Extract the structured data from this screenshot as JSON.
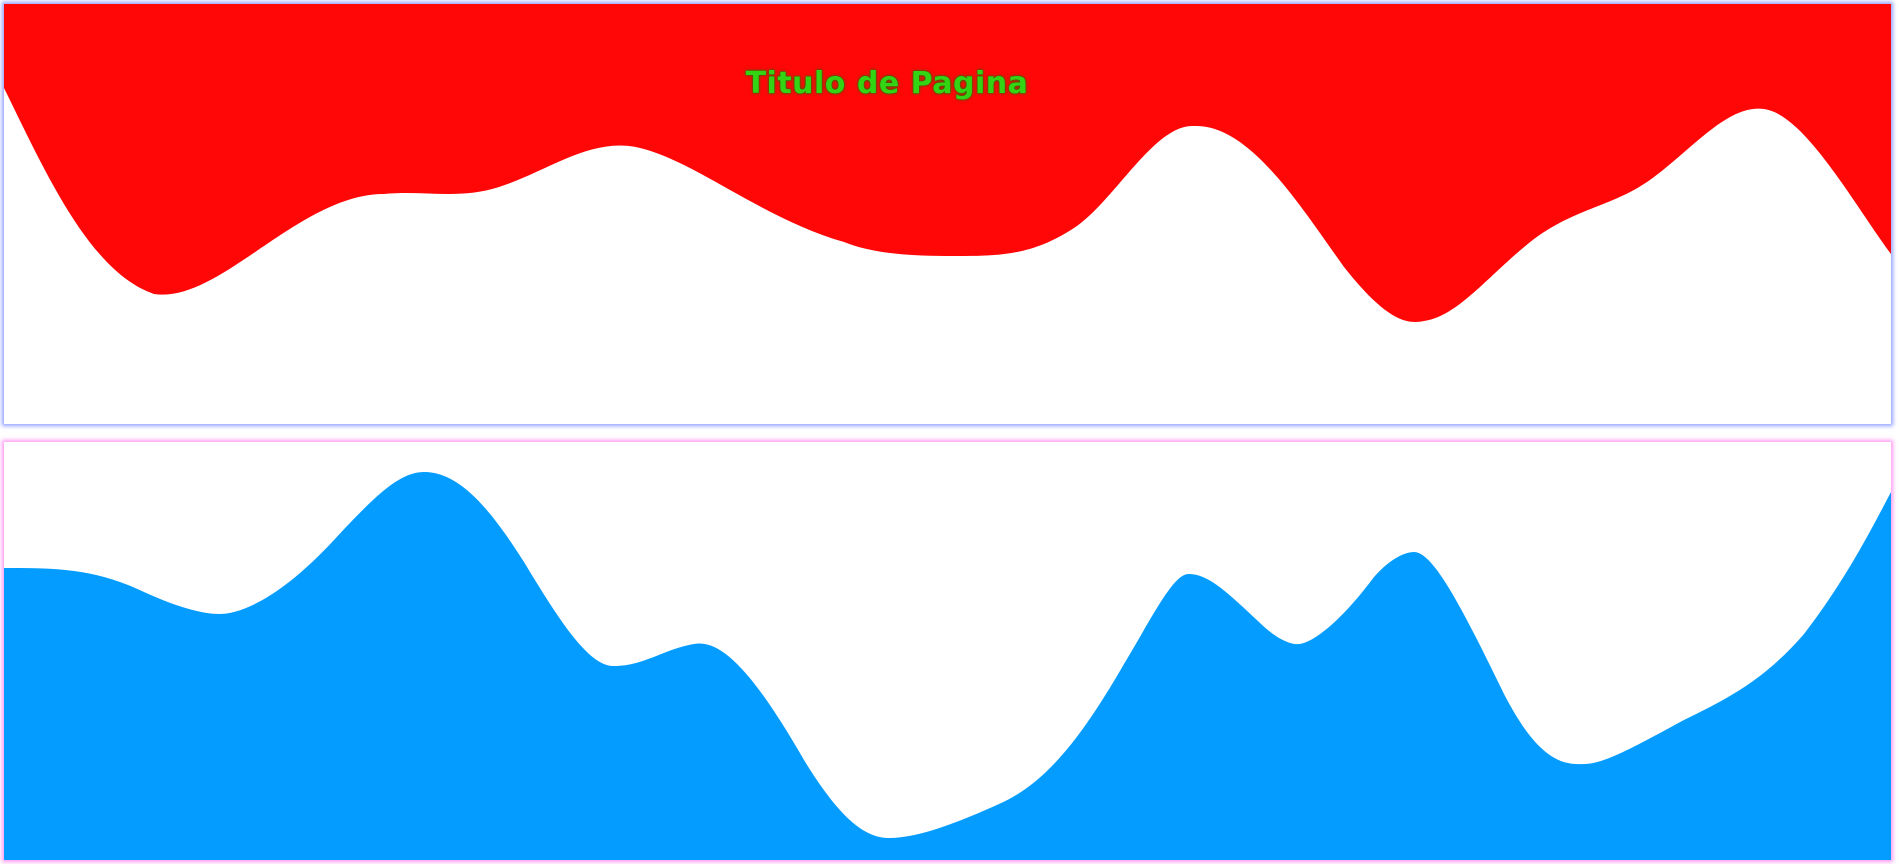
{
  "header": {
    "title": "Titulo de Pagina"
  },
  "colors": {
    "top_wave": "#ff0707",
    "bottom_wave": "#049dff",
    "title_text": "#33d414",
    "top_panel_glow": "#6e82ff",
    "bottom_panel_glow": "#ff78f0"
  }
}
